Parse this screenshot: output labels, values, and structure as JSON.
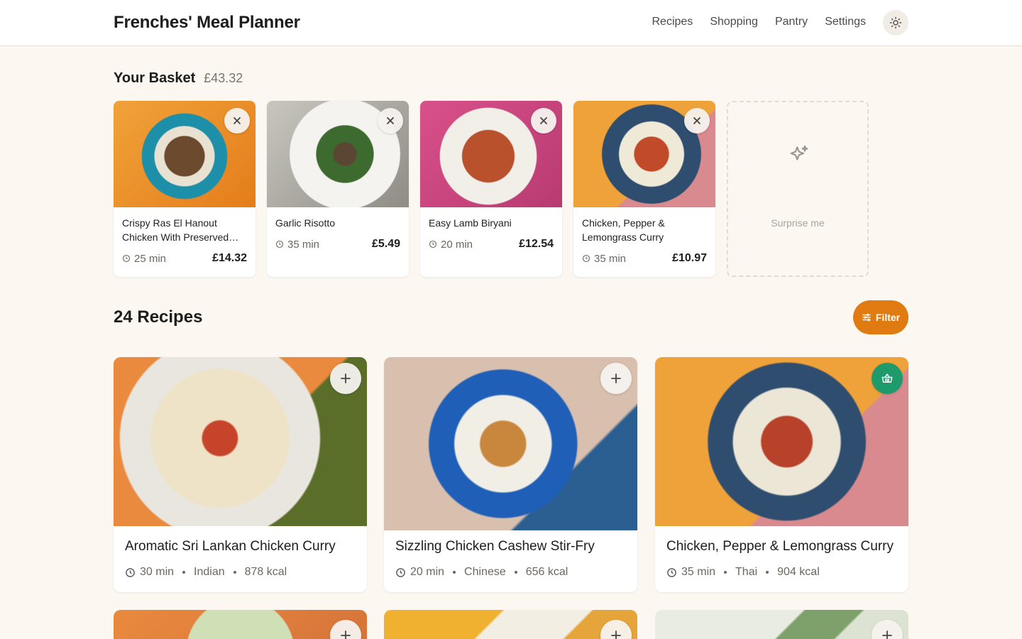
{
  "header": {
    "brand": "Frenches' Meal Planner",
    "nav": [
      "Recipes",
      "Shopping",
      "Pantry",
      "Settings"
    ],
    "theme_icon": "sun-icon"
  },
  "basket": {
    "title": "Your Basket",
    "total": "£43.32",
    "items": [
      {
        "name": "Crispy Ras El Hanout Chicken With Preserved Lemon",
        "time": "25 min",
        "price": "£14.32"
      },
      {
        "name": "Garlic Risotto",
        "time": "35 min",
        "price": "£5.49"
      },
      {
        "name": "Easy Lamb Biryani",
        "time": "20 min",
        "price": "£12.54"
      },
      {
        "name": "Chicken, Pepper & Lemongrass Curry",
        "time": "35 min",
        "price": "£10.97"
      }
    ],
    "surprise_label": "Surprise me"
  },
  "recipes": {
    "title": "24 Recipes",
    "filter_label": "Filter",
    "cards": [
      {
        "name": "Aromatic Sri Lankan Chicken Curry",
        "time": "30 min",
        "cuisine": "Indian",
        "kcal": "878 kcal",
        "in_basket": false
      },
      {
        "name": "Sizzling Chicken Cashew Stir-Fry",
        "time": "20 min",
        "cuisine": "Chinese",
        "kcal": "656 kcal",
        "in_basket": false
      },
      {
        "name": "Chicken, Pepper & Lemongrass Curry",
        "time": "35 min",
        "cuisine": "Thai",
        "kcal": "904 kcal",
        "in_basket": true
      }
    ]
  },
  "colors": {
    "accent": "#e07b12",
    "in_basket": "#1f9a6b",
    "background": "#fcf8f1"
  }
}
